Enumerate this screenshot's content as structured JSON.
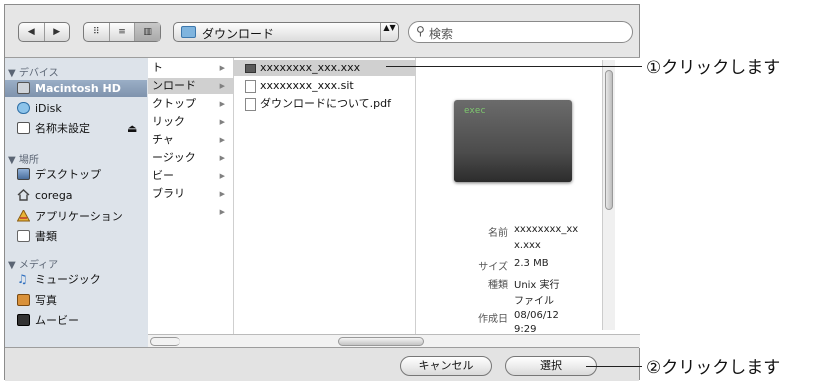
{
  "toolbar": {
    "nav_back": "◀",
    "nav_forward": "▶",
    "view_icon": "⠿",
    "view_list": "≡",
    "view_column": "▥",
    "path_label": "ダウンロード",
    "path_arrows": "▲▼",
    "search_placeholder": "検索"
  },
  "sidebar": {
    "devices_header": "▼ デバイス",
    "devices": [
      "Macintosh HD",
      "iDisk",
      "名称未設定"
    ],
    "eject": "⏏",
    "places_header": "▼ 場所",
    "places": [
      "デスクトップ",
      "corega",
      "アプリケーション",
      "書類"
    ],
    "media_header": "▼ メディア",
    "media": [
      "ミュージック",
      "写真",
      "ムービー"
    ]
  },
  "column1": {
    "items": [
      "ト",
      "ンロード",
      "クトップ",
      "リック",
      "チャ",
      "ージック",
      "ビー",
      "ブラリ",
      ""
    ],
    "arrow": "▶"
  },
  "column2": {
    "files": [
      "xxxxxxxx_xxx.xxx",
      "xxxxxxxx_xxx.sit",
      "ダウンロードについて.pdf"
    ]
  },
  "preview": {
    "thumb_text": "exec",
    "name_label": "名前",
    "name_value_1": "xxxxxxxx_xx",
    "name_value_2": "x.xxx",
    "size_label": "サイズ",
    "size_value": "2.3 MB",
    "kind_label": "種類",
    "kind_value_1": "Unix 実行",
    "kind_value_2": "ファイル",
    "created_label": "作成日",
    "created_value_1": "08/06/12",
    "created_value_2": "9:29"
  },
  "footer": {
    "cancel": "キャンセル",
    "select": "選択"
  },
  "annotations": {
    "step1": "①クリックします",
    "step2": "②クリックします"
  }
}
